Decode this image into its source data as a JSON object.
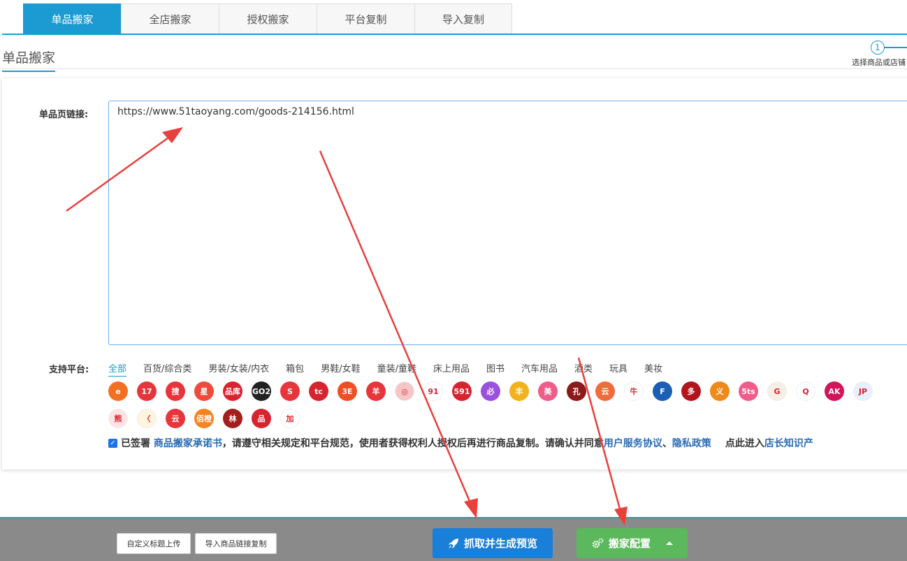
{
  "tabs": [
    "单品搬家",
    "全店搬家",
    "授权搬家",
    "平台复制",
    "导入复制"
  ],
  "section_title": "单品搬家",
  "step": {
    "number": "1",
    "label": "选择商品或店铺"
  },
  "form": {
    "url_label": "单品页链接:",
    "url_value": "https://www.51taoyang.com/goods-214156.html",
    "platform_label": "支持平台:"
  },
  "categories": [
    "全部",
    "百货/综合类",
    "男装/女装/内衣",
    "箱包",
    "男鞋/女鞋",
    "童装/童鞋",
    "床上用品",
    "图书",
    "汽车用品",
    "酒类",
    "玩具",
    "美妆"
  ],
  "platforms_row1": [
    {
      "t": "e",
      "c": "#f37021"
    },
    {
      "t": "17",
      "c": "#e8353b"
    },
    {
      "t": "搜",
      "c": "#e8353b"
    },
    {
      "t": "星",
      "c": "#ef4b3c"
    },
    {
      "t": "品库",
      "c": "#d9232e"
    },
    {
      "t": "GO2",
      "c": "#222222"
    },
    {
      "t": "S",
      "c": "#e8353b"
    },
    {
      "t": "tc",
      "c": "#d9232e"
    },
    {
      "t": "3E",
      "c": "#f04e23"
    },
    {
      "t": "羊",
      "c": "#e8353b"
    },
    {
      "t": "◎",
      "c": "#f6c6c6"
    },
    {
      "t": "91",
      "c": "#ffffff"
    },
    {
      "t": "591",
      "c": "#d9232e"
    },
    {
      "t": "必",
      "c": "#9b51e0"
    },
    {
      "t": "丰",
      "c": "#f2b21b"
    },
    {
      "t": "美",
      "c": "#f25c8a"
    },
    {
      "t": "孔",
      "c": "#8b1a1a"
    },
    {
      "t": "云",
      "c": "#f26b3a"
    },
    {
      "t": "牛",
      "c": "#ffffff"
    },
    {
      "t": "F",
      "c": "#1a5fb4"
    },
    {
      "t": "多",
      "c": "#b3131b"
    },
    {
      "t": "义",
      "c": "#ef8a1a"
    },
    {
      "t": "5ts",
      "c": "#f25c8a"
    },
    {
      "t": "G",
      "c": "#f7efe5"
    },
    {
      "t": "Q",
      "c": "#ffffff"
    },
    {
      "t": "AK",
      "c": "#d4145a"
    },
    {
      "t": "JP",
      "c": "#e8f1fb"
    }
  ],
  "platforms_row2": [
    {
      "t": "熊",
      "c": "#fde3e3"
    },
    {
      "t": "〈",
      "c": "#fff4e0"
    },
    {
      "t": "云",
      "c": "#e8353b"
    },
    {
      "t": "佰橙",
      "c": "#f5831f"
    },
    {
      "t": "林",
      "c": "#a51d1d"
    },
    {
      "t": "品",
      "c": "#d9232e"
    },
    {
      "t": "加",
      "c": "#ffffff"
    }
  ],
  "agreement": {
    "checked": "✓",
    "signed": "已签署",
    "pledge_link": "商品搬家承诺书",
    "text": "，请遵守相关规定和平台规范，使用者获得权利人授权后再进行商品复制。请确认并同意",
    "terms_link": "用户服务协议",
    "sep": "、",
    "privacy_link": "隐私政策",
    "enter_text": "点此进入",
    "kb_link": "店长知识产"
  },
  "bottom": {
    "custom_title_upload": "自定义标题上传",
    "import_links_copy": "导入商品链接复制",
    "fetch_preview": "抓取并生成预览",
    "move_config": "搬家配置"
  },
  "colors": {
    "accent": "#1b9bd1",
    "annotation": "#e8403d",
    "primary_button": "#1a7fd9",
    "success_button": "#5cb85c"
  }
}
